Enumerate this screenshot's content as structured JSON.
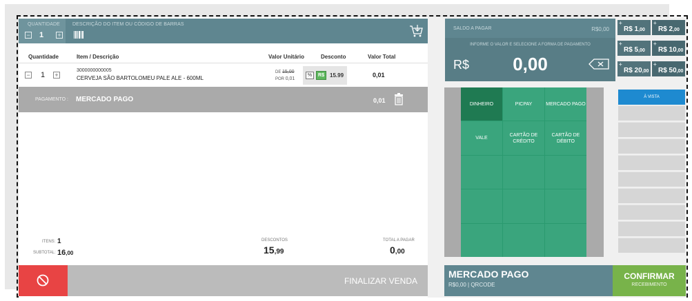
{
  "sale": {
    "qty_label": "QUANTIDADE",
    "qty_value": "1",
    "desc_label": "DESCRIÇÃO DO ITEM OU CÓDIGO DE BARRAS",
    "columns": {
      "quantity": "Quantidade",
      "item": "Item / Descrição",
      "unit": "Valor Unitário",
      "discount": "Desconto",
      "total": "Valor Total"
    },
    "items": [
      {
        "qty": "1",
        "code": "3000000000005",
        "name": "CERVEJA SÃO BARTOLOMEU PALE ALE - 600ML",
        "de_label": "DE",
        "de_value": "15,00",
        "por_label": "POR",
        "por_value": "0,01",
        "pct_label": "%",
        "rs_label": "R$",
        "discount": "15.99",
        "total": "0,01"
      }
    ],
    "payment": {
      "label": "PAGAMENTO :",
      "method": "MERCADO PAGO",
      "value": "0,01"
    },
    "summary": {
      "items_label": "ITENS:",
      "items_value": "1",
      "subtotal_label": "SUBTOTAL:",
      "subtotal_int": "16",
      "subtotal_dec": ",00",
      "discounts_label": "DESCONTOS",
      "discounts_int": "15",
      "discounts_dec": ",99",
      "total_label": "TOTAL A PAGAR",
      "total_int": "0",
      "total_dec": ",00"
    },
    "finalize_label": "FINALIZAR VENDA"
  },
  "pay": {
    "saldo_label": "SALDO A PAGAR",
    "saldo_value": "R$0,00",
    "hint": "INFORME O VALOR E SELECIONE A FORMA DE PAGAMENTO",
    "currency": "R$",
    "amount": "0,00",
    "cash": [
      {
        "label": "R$ 1",
        "cents": ",00"
      },
      {
        "label": "R$ 2",
        "cents": ",00"
      },
      {
        "label": "R$ 5",
        "cents": ",00"
      },
      {
        "label": "R$ 10",
        "cents": ",00"
      },
      {
        "label": "R$ 20",
        "cents": ",00"
      },
      {
        "label": "R$ 50",
        "cents": ",00"
      }
    ],
    "methods": [
      "DINHEIRO",
      "PICPAY",
      "MERCADO PAGO",
      "VALE",
      "CARTÃO DE CRÉDITO",
      "CARTÃO DE DÉBITO"
    ],
    "active_method": "DINHEIRO",
    "option": "À VISTA",
    "selected_name": "MERCADO PAGO",
    "selected_sub": "R$0,00 | QRCODE",
    "confirm_label": "CONFIRMAR",
    "confirm_sub": "RECEBIMENTO"
  },
  "colors": {
    "header": "#5f8690",
    "grid": "#3aa57d",
    "grid_active": "#1f7a52",
    "cancel": "#e84444",
    "confirm": "#78b34a",
    "option": "#1e8ad0"
  }
}
